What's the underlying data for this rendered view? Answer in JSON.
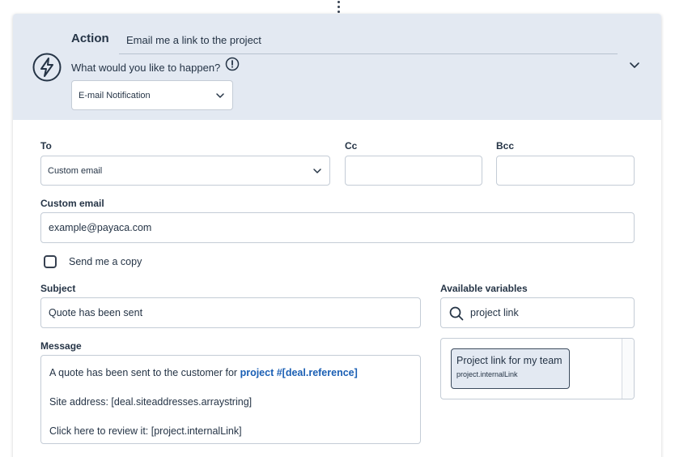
{
  "header": {
    "action_label": "Action",
    "action_name": "Email me a link to the project",
    "question": "What would you like to happen?",
    "action_type": "E-mail Notification"
  },
  "fields": {
    "to_label": "To",
    "to_value": "Custom email",
    "cc_label": "Cc",
    "cc_value": "",
    "bcc_label": "Bcc",
    "bcc_value": "",
    "custom_email_label": "Custom email",
    "custom_email_value": "example@payaca.com",
    "send_copy_label": "Send me a copy",
    "send_copy_checked": false,
    "subject_label": "Subject",
    "subject_value": "Quote has been sent",
    "message_label": "Message"
  },
  "message": {
    "line1_prefix": "A quote has been sent to the customer for ",
    "line1_link": "project #[deal.reference]",
    "line2": "Site address: [deal.siteaddresses.arraystring]",
    "line3": "Click here to review it: [project.internalLink]"
  },
  "variables": {
    "label": "Available variables",
    "search_value": "project link",
    "items": [
      {
        "label": "Project link for my team",
        "key": "project.internalLink"
      }
    ]
  },
  "colors": {
    "header_bg": "#e3e9f2",
    "link": "#1a5fb4",
    "text": "#253446",
    "border": "#c4ccd6"
  }
}
